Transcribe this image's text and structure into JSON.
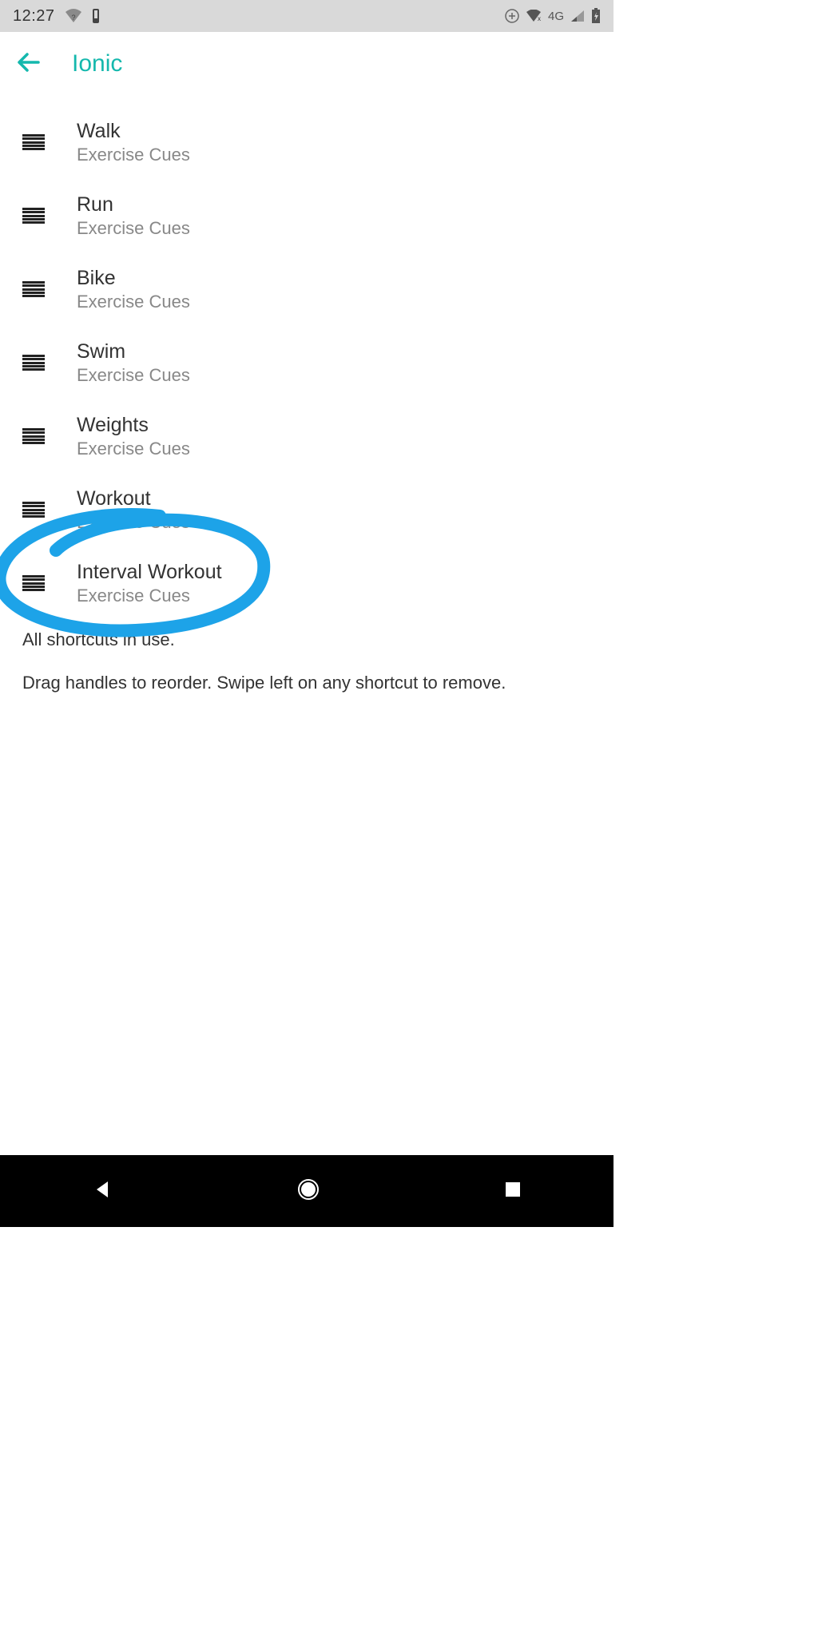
{
  "statusbar": {
    "time": "12:27",
    "network": "4G"
  },
  "header": {
    "title": "Ionic"
  },
  "exercises": [
    {
      "title": "Walk",
      "subtitle": "Exercise Cues"
    },
    {
      "title": "Run",
      "subtitle": "Exercise Cues"
    },
    {
      "title": "Bike",
      "subtitle": "Exercise Cues"
    },
    {
      "title": "Swim",
      "subtitle": "Exercise Cues"
    },
    {
      "title": "Weights",
      "subtitle": "Exercise Cues"
    },
    {
      "title": "Workout",
      "subtitle": "Exercise Cues"
    },
    {
      "title": "Interval Workout",
      "subtitle": "Exercise Cues"
    }
  ],
  "footer": {
    "shortcuts_status": "All shortcuts in use.",
    "instructions": "Drag handles to reorder. Swipe left on any shortcut to remove."
  },
  "annotation": {
    "highlighted_index": 6,
    "color": "#1da3e8"
  }
}
